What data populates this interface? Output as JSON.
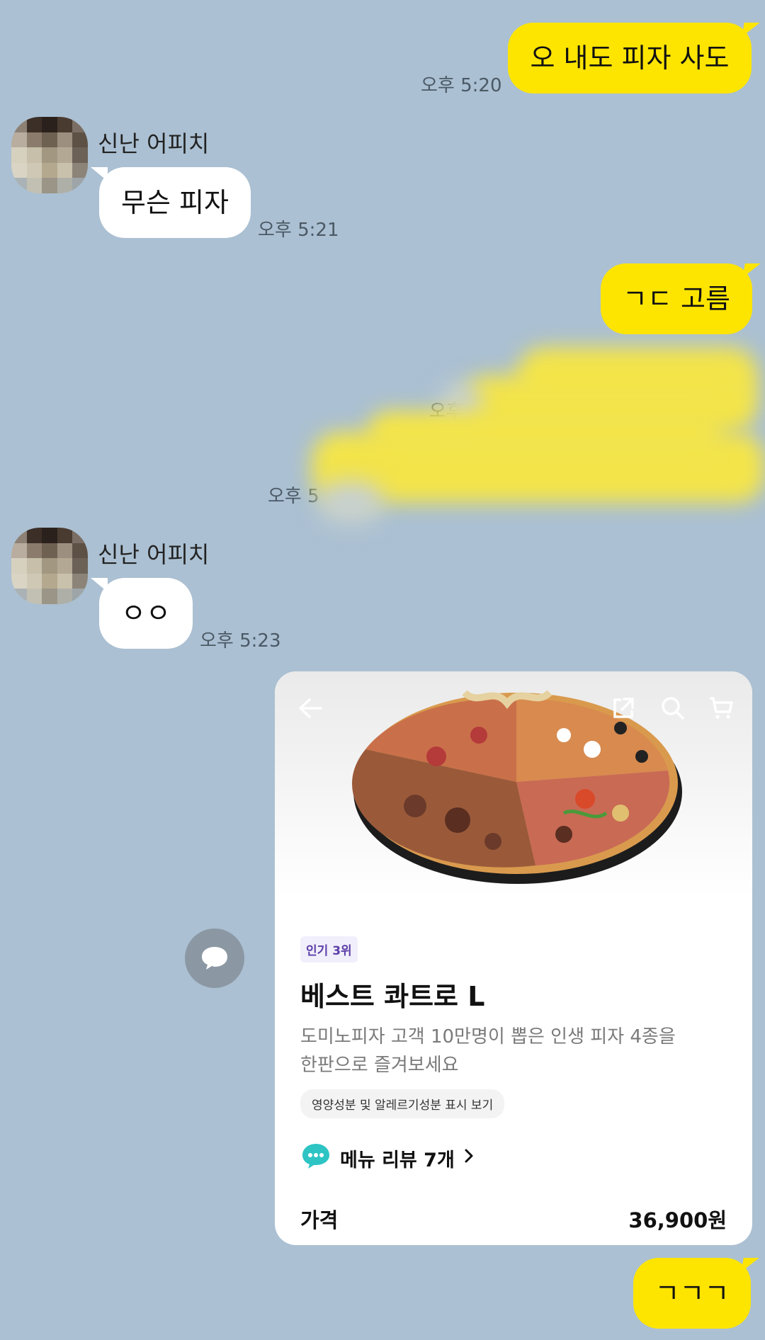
{
  "messages": {
    "m1": {
      "text": "오 내도 피자 사도",
      "time": "오후 5:20"
    },
    "m2": {
      "sender": "신난 어피치",
      "text": "무슨 피자",
      "time": "오후 5:21"
    },
    "m3": {
      "text": "ㄱㄷ 고름"
    },
    "m4_time_partial": "오후",
    "m5_time_partial": "오후 5",
    "m6": {
      "sender": "신난 어피치",
      "text": "ㅇㅇ",
      "time": "오후 5:23"
    },
    "m7": {
      "text": "ㄱㄱㄱ"
    }
  },
  "card": {
    "badge": "인기 3위",
    "name": "베스트 콰트로 L",
    "description_line1": "도미노피자 고객 10만명이 뽑은 인생 피자 4종을",
    "description_line2": "한판으로 즐겨보세요",
    "nutrition_link": "영양성분 및 알레르기성분 표시 보기",
    "review_label": "메뉴 리뷰 7개",
    "price_label": "가격",
    "price_value": "36,900원"
  },
  "icons": {
    "back": "arrow-left-icon",
    "share": "external-link-icon",
    "search": "search-icon",
    "cart": "cart-icon",
    "review": "speech-bubble-icon",
    "chevron": "chevron-right-icon",
    "float_share": "chat-share-icon"
  },
  "colors": {
    "background": "#abc0d2",
    "my_bubble": "#fee500",
    "their_bubble": "#ffffff",
    "badge_text": "#5c3ea8",
    "review_icon": "#2ec4c4"
  }
}
